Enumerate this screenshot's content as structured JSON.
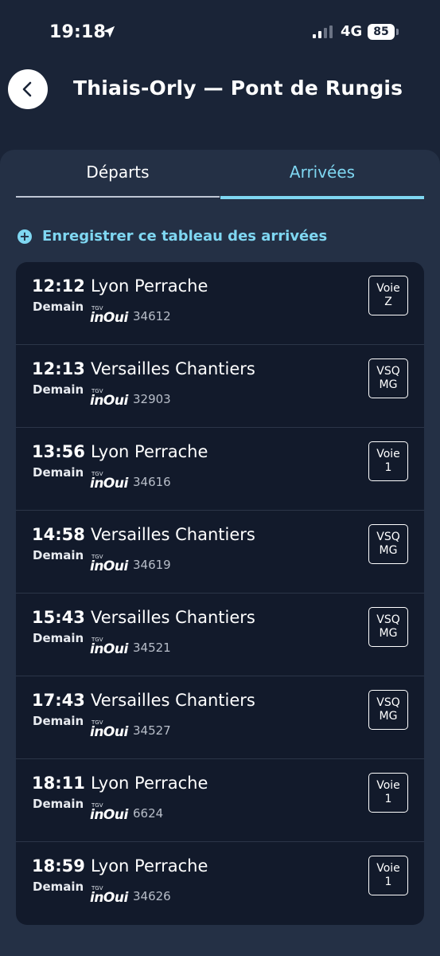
{
  "status_bar": {
    "time": "19:18",
    "location_icon": "location-arrow-icon",
    "signal_icon": "cellular-signal-icon",
    "network": "4G",
    "battery": "85"
  },
  "header": {
    "back_icon": "chevron-left-icon",
    "title": "Thiais-Orly — Pont de Rungis"
  },
  "tabs": [
    {
      "label": "Départs",
      "active": false
    },
    {
      "label": "Arrivées",
      "active": true
    }
  ],
  "save_action": {
    "icon": "plus-circle-icon",
    "label": "Enregistrer ce tableau des arrivées"
  },
  "colors": {
    "background": "#1a2437",
    "panel": "#243045",
    "list": "#121a2b",
    "accent": "#7fd7f2"
  },
  "arrivals": [
    {
      "time": "12:12",
      "destination": "Lyon Perrache",
      "day": "Demain",
      "brand_top": "TGV",
      "brand": "inOui",
      "train_number": "34612",
      "track_line1": "Voie",
      "track_line2": "Z"
    },
    {
      "time": "12:13",
      "destination": "Versailles Chantiers",
      "day": "Demain",
      "brand_top": "TGV",
      "brand": "inOui",
      "train_number": "32903",
      "track_line1": "VSQ",
      "track_line2": "MG"
    },
    {
      "time": "13:56",
      "destination": "Lyon Perrache",
      "day": "Demain",
      "brand_top": "TGV",
      "brand": "inOui",
      "train_number": "34616",
      "track_line1": "Voie",
      "track_line2": "1"
    },
    {
      "time": "14:58",
      "destination": "Versailles Chantiers",
      "day": "Demain",
      "brand_top": "TGV",
      "brand": "inOui",
      "train_number": "34619",
      "track_line1": "VSQ",
      "track_line2": "MG"
    },
    {
      "time": "15:43",
      "destination": "Versailles Chantiers",
      "day": "Demain",
      "brand_top": "TGV",
      "brand": "inOui",
      "train_number": "34521",
      "track_line1": "VSQ",
      "track_line2": "MG"
    },
    {
      "time": "17:43",
      "destination": "Versailles Chantiers",
      "day": "Demain",
      "brand_top": "TGV",
      "brand": "inOui",
      "train_number": "34527",
      "track_line1": "VSQ",
      "track_line2": "MG"
    },
    {
      "time": "18:11",
      "destination": "Lyon Perrache",
      "day": "Demain",
      "brand_top": "TGV",
      "brand": "inOui",
      "train_number": "6624",
      "track_line1": "Voie",
      "track_line2": "1"
    },
    {
      "time": "18:59",
      "destination": "Lyon Perrache",
      "day": "Demain",
      "brand_top": "TGV",
      "brand": "inOui",
      "train_number": "34626",
      "track_line1": "Voie",
      "track_line2": "1"
    }
  ]
}
